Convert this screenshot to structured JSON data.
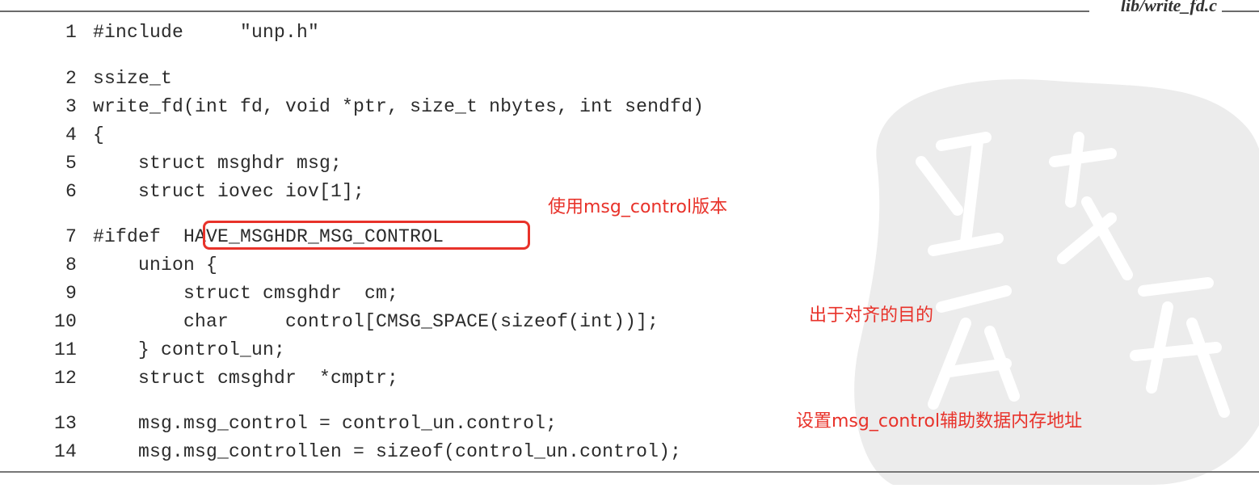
{
  "header": {
    "filename": "lib/write_fd.c"
  },
  "code": {
    "lines": [
      {
        "num": "1",
        "text": "#include     \"unp.h\""
      },
      {
        "num": "2",
        "text": "ssize_t"
      },
      {
        "num": "3",
        "text": "write_fd(int fd, void *ptr, size_t nbytes, int sendfd)"
      },
      {
        "num": "4",
        "text": "{"
      },
      {
        "num": "5",
        "text": "    struct msghdr msg;"
      },
      {
        "num": "6",
        "text": "    struct iovec iov[1];"
      },
      {
        "num": "7",
        "text": "#ifdef  HAVE_MSGHDR_MSG_CONTROL"
      },
      {
        "num": "8",
        "text": "    union {"
      },
      {
        "num": "9",
        "text": "        struct cmsghdr  cm;"
      },
      {
        "num": "10",
        "text": "        char     control[CMSG_SPACE(sizeof(int))];"
      },
      {
        "num": "11",
        "text": "    } control_un;"
      },
      {
        "num": "12",
        "text": "    struct cmsghdr  *cmptr;"
      },
      {
        "num": "13",
        "text": "    msg.msg_control = control_un.control;"
      },
      {
        "num": "14",
        "text": "    msg.msg_controllen = sizeof(control_un.control);"
      }
    ]
  },
  "annotations": {
    "note_version": "使用msg_control版本",
    "note_align": "出于对齐的目的",
    "note_address": "设置msg_control辅助数据内存地址"
  },
  "colors": {
    "annotation": "#e8322a",
    "code": "#2b2b2b",
    "watermark": "#ececec"
  },
  "watermark": {
    "icon": "seal-stamp-icon"
  }
}
